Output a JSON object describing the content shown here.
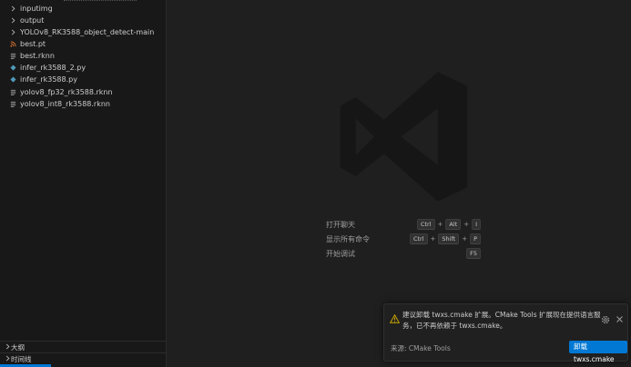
{
  "explorer": {
    "items": [
      {
        "type": "folder",
        "label": "inputimg"
      },
      {
        "type": "folder",
        "label": "output"
      },
      {
        "type": "folder",
        "label": "YOLOv8_RK3588_object_detect-main"
      },
      {
        "type": "rss",
        "label": "best.pt"
      },
      {
        "type": "file",
        "label": "best.rknn"
      },
      {
        "type": "python",
        "label": "infer_rk3588_2.py"
      },
      {
        "type": "python",
        "label": "infer_rk3588.py"
      },
      {
        "type": "file",
        "label": "yolov8_fp32_rk3588.rknn"
      },
      {
        "type": "file",
        "label": "yolov8_int8_rk3588.rknn"
      }
    ],
    "sections": [
      {
        "label": "大纲"
      },
      {
        "label": "时间线"
      }
    ]
  },
  "editor": {
    "shortcuts": [
      {
        "label": "打开聊天",
        "keys": [
          "Ctrl",
          "Alt",
          "I"
        ]
      },
      {
        "label": "显示所有命令",
        "keys": [
          "Ctrl",
          "Shift",
          "P"
        ]
      },
      {
        "label": "开始调试",
        "keys": [
          "F5"
        ]
      }
    ]
  },
  "notification": {
    "line1": "建议卸载 twxs.cmake 扩展。CMake Tools 扩展现在提供语言服",
    "line2": "务，已不再依赖于 twxs.cmake。",
    "source": "来源: CMake Tools",
    "button": "卸载 twxs.cmake"
  },
  "colors": {
    "accent": "#0078d4",
    "warning": "#cca700",
    "python": "#519aba",
    "rss": "#e37933"
  }
}
